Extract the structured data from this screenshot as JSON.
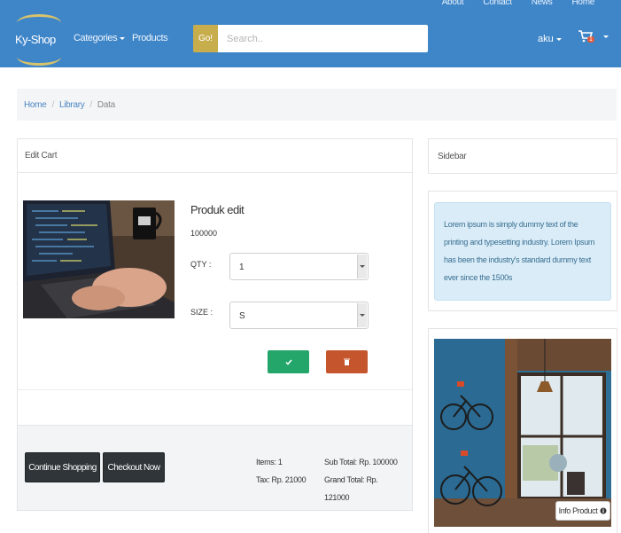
{
  "header": {
    "top_links": [
      "About",
      "Contact",
      "News",
      "Home"
    ],
    "brand": "Ky-Shop",
    "nav": [
      {
        "label": "Categories",
        "has_dropdown": true
      },
      {
        "label": "Products",
        "has_dropdown": false
      }
    ],
    "search": {
      "button_label": "Go!",
      "placeholder": "Search.."
    },
    "user": {
      "label": "aku"
    },
    "cart": {
      "icon": "shopping-cart-icon",
      "badge": "1"
    },
    "colors": {
      "navbar": "#3f86c9",
      "accent": "#c7ad4b"
    }
  },
  "breadcrumb": {
    "items": [
      "Home",
      "Library"
    ],
    "active": "Data"
  },
  "edit_cart": {
    "heading": "Edit Cart",
    "product": {
      "title": "Produk edit",
      "code": "100000",
      "qty_label": "QTY :",
      "qty_value": "1",
      "size_label": "SIZE :",
      "size_value": "S"
    },
    "actions": {
      "update_icon": "check-icon",
      "delete_icon": "trash-icon",
      "update_color": "#24a66b",
      "delete_color": "#c4552d"
    },
    "footer": {
      "continue_label": "Continue Shopping",
      "checkout_label": "Checkout Now",
      "items": "Items: 1",
      "tax": "Tax: Rp. 21000",
      "sub_total": "Sub Total: Rp. 100000",
      "grand_total_label": "Grand Total: Rp.",
      "grand_total_value": "121000"
    }
  },
  "sidebar": {
    "heading": "Sidebar",
    "lorem": "Lorem ipsum is simply dummy text of the printing and typesetting industry. Lorem Ipsum has been the industry's standard dummy text ever since the 1500s",
    "image_button": "Info Product"
  }
}
